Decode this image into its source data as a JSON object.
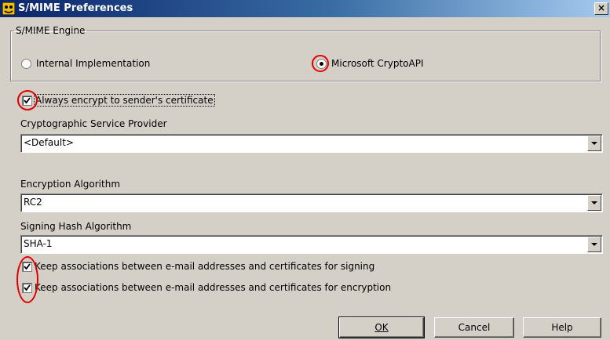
{
  "window": {
    "title": "S/MIME Preferences",
    "close_glyph": "×"
  },
  "engine": {
    "legend": "S/MIME Engine",
    "options": [
      {
        "label": "Internal Implementation",
        "selected": false
      },
      {
        "label": "Microsoft CryptoAPI",
        "selected": true
      }
    ]
  },
  "always_encrypt": {
    "label": "Always encrypt to sender's certificate",
    "checked": true
  },
  "csp": {
    "label": "Cryptographic Service Provider",
    "value": "<Default>"
  },
  "encryption": {
    "label": "Encryption Algorithm",
    "value": "RC2"
  },
  "signing_hash": {
    "label": "Signing Hash Algorithm",
    "value": "SHA-1"
  },
  "keep_signing": {
    "label": "Keep associations between  e-mail addresses and certificates for signing",
    "checked": true
  },
  "keep_encryption": {
    "label": "Keep associations between  e-mail addresses and certificates for encryption",
    "checked": true
  },
  "buttons": {
    "ok": "OK",
    "cancel": "Cancel",
    "help": "Help"
  },
  "colors": {
    "annotation": "#e00000",
    "titlebar": "#0a246a"
  }
}
